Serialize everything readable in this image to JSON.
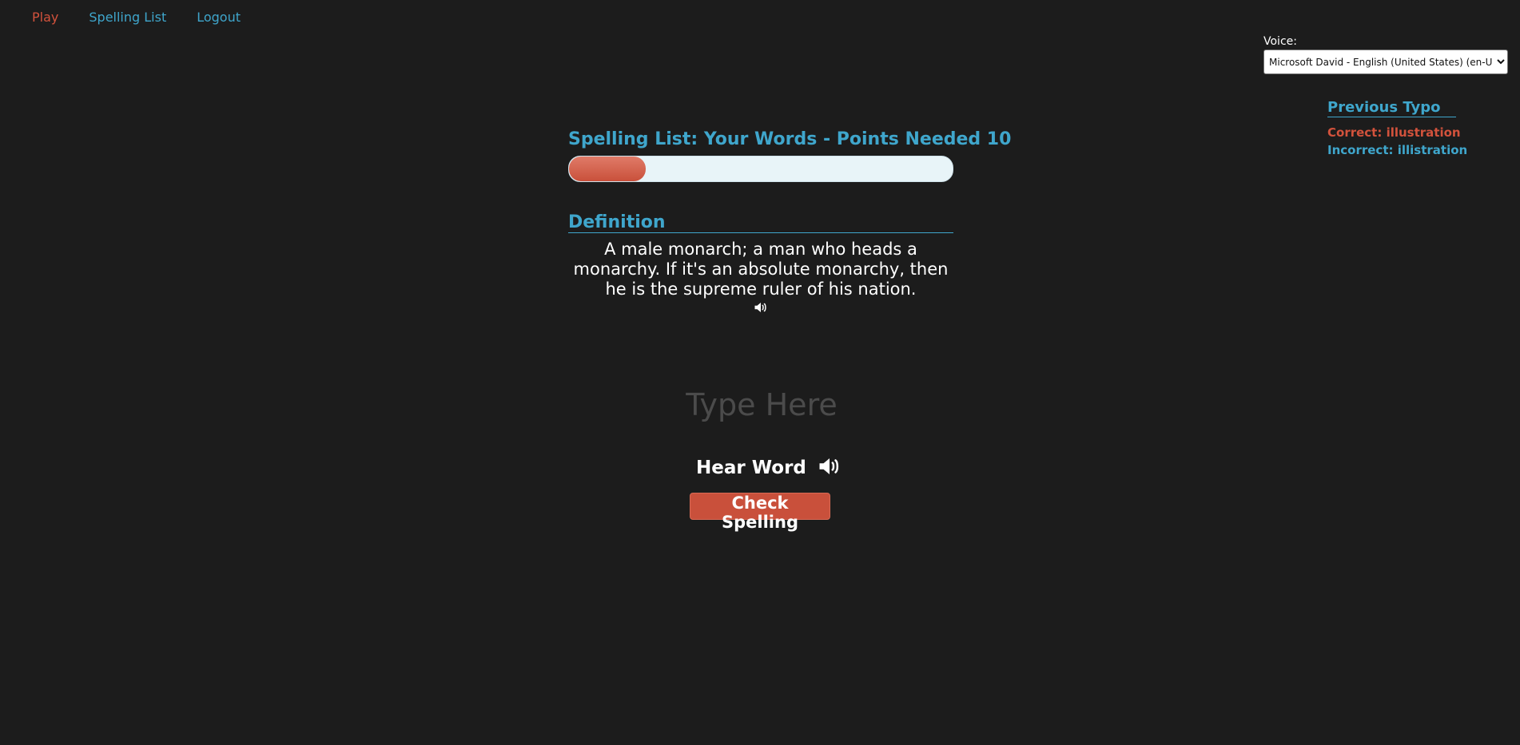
{
  "nav": {
    "play": "Play",
    "spelling_list": "Spelling List",
    "logout": "Logout"
  },
  "voice": {
    "label": "Voice:",
    "selected": "Microsoft David - English (United States) (en-US)"
  },
  "previous_typo": {
    "title": "Previous Typo",
    "correct": "Correct: illustration",
    "incorrect": "Incorrect: illistration"
  },
  "main": {
    "title": "Spelling List: Your Words - Points Needed 10",
    "progress_fraction": 0.2,
    "definition_header": "Definition",
    "definition_text": "A male monarch; a man who heads a monarchy. If it's an absolute monarchy, then he is the supreme ruler of his nation."
  },
  "input": {
    "placeholder": "Type Here",
    "value": ""
  },
  "hear_word": {
    "label": "Hear Word"
  },
  "check_button": {
    "label": "Check Spelling"
  },
  "colors": {
    "background": "#1c1c1c",
    "accent_blue": "#3fa6cc",
    "accent_red": "#d2523c",
    "progress_track": "#e8f4f8"
  },
  "icons": {
    "definition_audio": "speaker-icon",
    "hear_word_audio": "speaker-icon",
    "voice_dropdown": "chevron-down-icon"
  }
}
